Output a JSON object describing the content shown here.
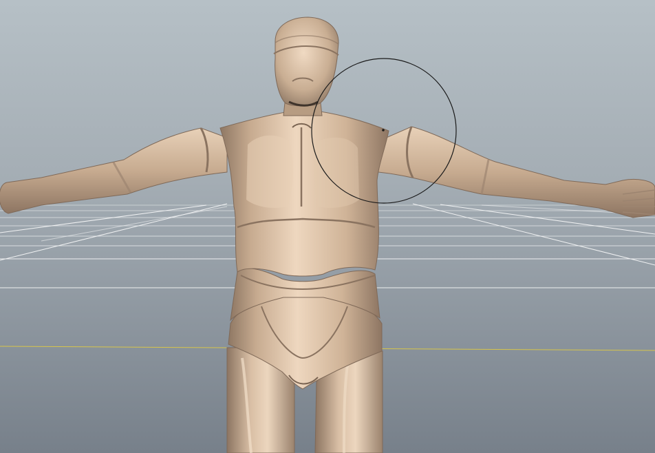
{
  "viewport": {
    "mode": "3d-perspective-viewport",
    "icons": {
      "grid": "grid-icon",
      "model": "humanoid-mesh-icon",
      "brush": "sculpt-brush-cursor-icon"
    },
    "colors": {
      "background_top": "#b6c0c6",
      "background_bottom": "#77808a",
      "grid_line": "#ffffff",
      "x_axis": "#d8c54a",
      "z_axis": "#e0d050",
      "mesh_base": "#c9ae93",
      "mesh_highlight": "#efd9c2",
      "mesh_shadow": "#8a7360",
      "brush_outline": "#1a1a1a"
    }
  }
}
